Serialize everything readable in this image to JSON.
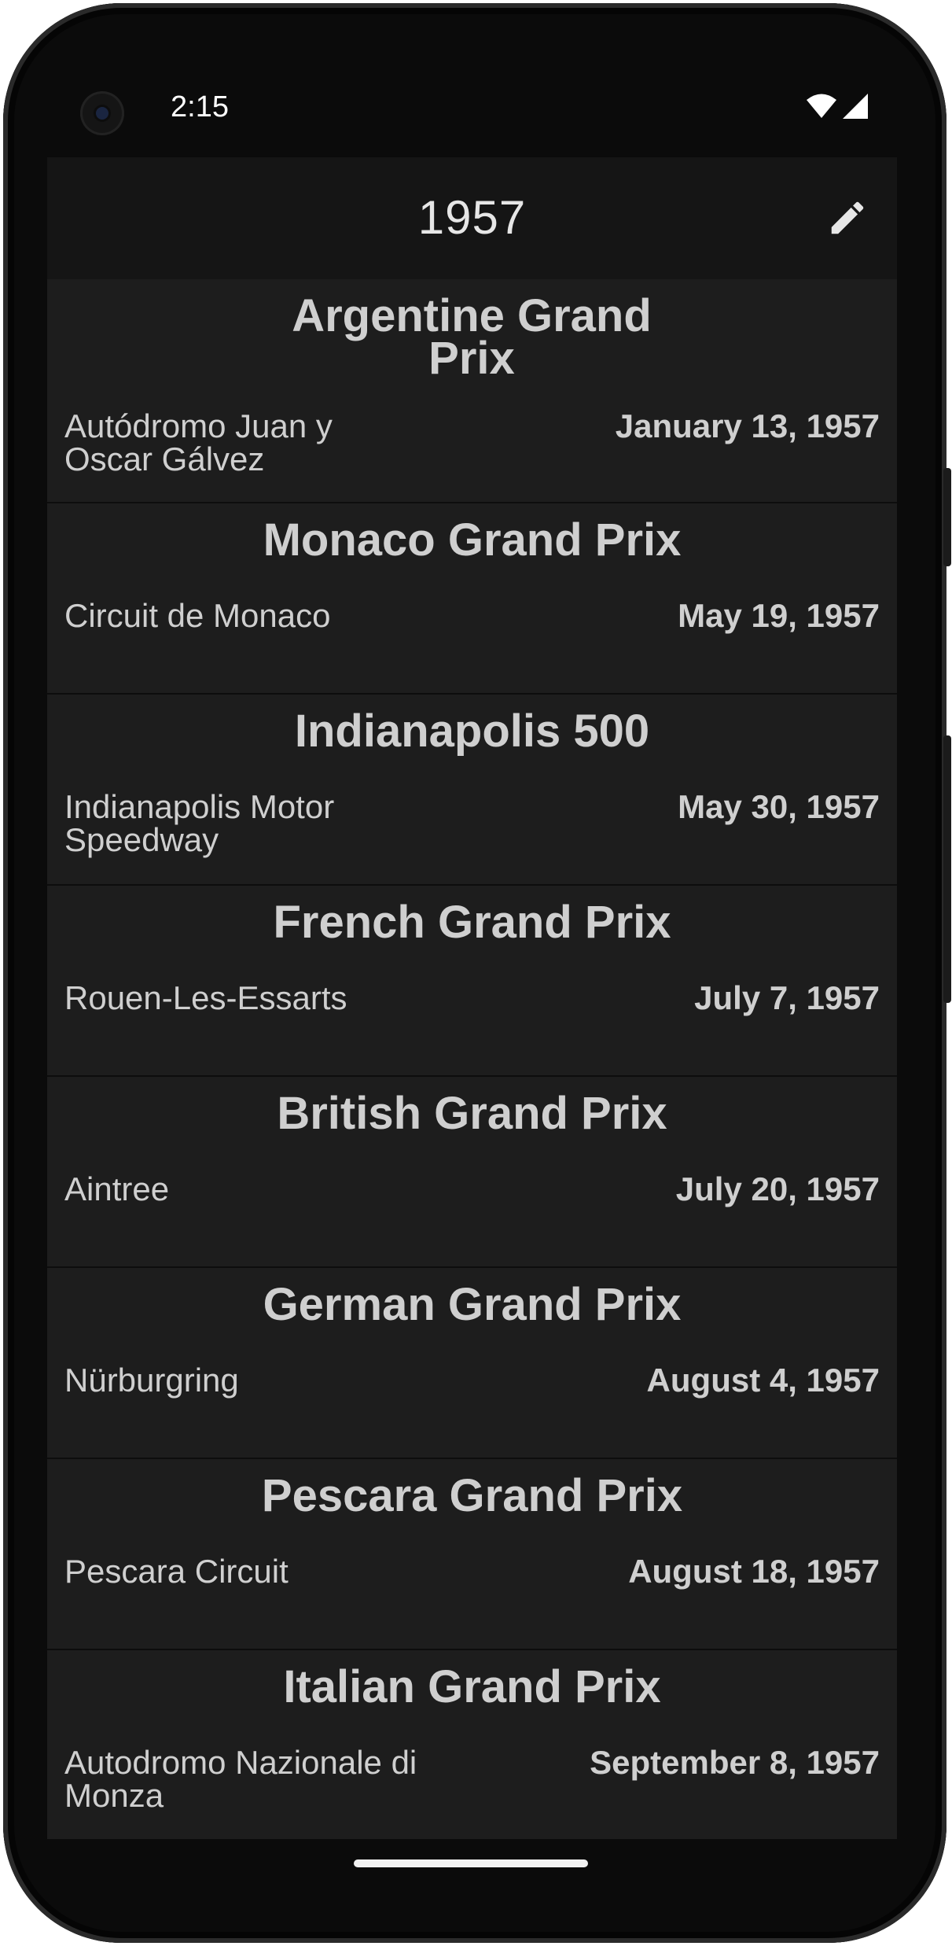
{
  "status": {
    "time": "2:15"
  },
  "appbar": {
    "title": "1957"
  },
  "races": [
    {
      "name": "Argentine Grand Prix",
      "circuit": "Autódromo Juan y Oscar Gálvez",
      "date": "January 13, 1957"
    },
    {
      "name": "Monaco Grand Prix",
      "circuit": "Circuit de Monaco",
      "date": "May 19, 1957"
    },
    {
      "name": "Indianapolis 500",
      "circuit": "Indianapolis Motor Speedway",
      "date": "May 30, 1957"
    },
    {
      "name": "French Grand Prix",
      "circuit": "Rouen-Les-Essarts",
      "date": "July 7, 1957"
    },
    {
      "name": "British Grand Prix",
      "circuit": "Aintree",
      "date": "July 20, 1957"
    },
    {
      "name": "German Grand Prix",
      "circuit": "Nürburgring",
      "date": "August 4, 1957"
    },
    {
      "name": "Pescara Grand Prix",
      "circuit": "Pescara Circuit",
      "date": "August 18, 1957"
    },
    {
      "name": "Italian Grand Prix",
      "circuit": "Autodromo Nazionale di Monza",
      "date": "September 8, 1957"
    }
  ]
}
